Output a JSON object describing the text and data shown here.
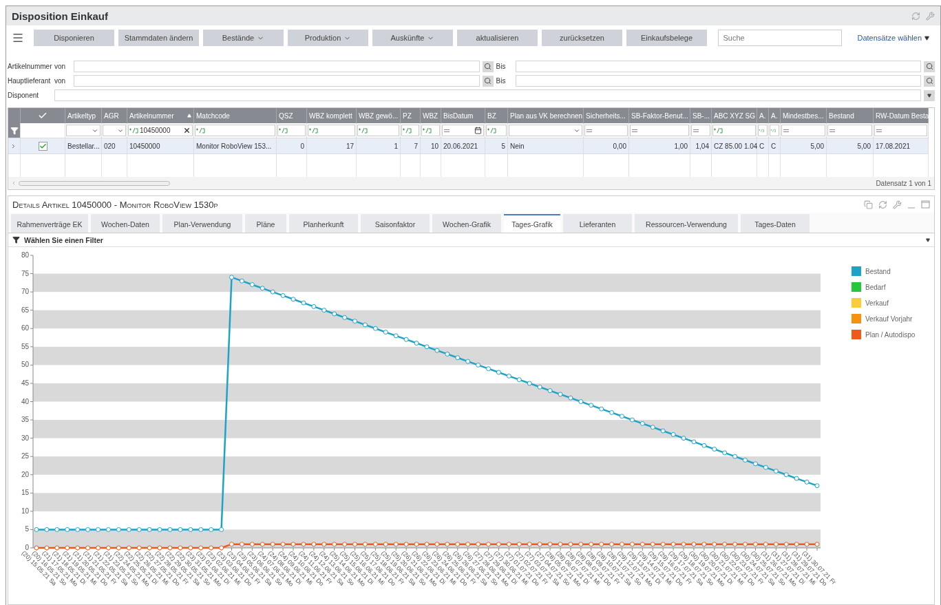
{
  "window": {
    "title": "Disposition Einkauf"
  },
  "toolbar": {
    "buttons": [
      {
        "label": "Disponieren",
        "dropdown": false
      },
      {
        "label": "Stammdaten ändern",
        "dropdown": false
      },
      {
        "label": "Bestände",
        "dropdown": true
      },
      {
        "label": "Produktion",
        "dropdown": true
      },
      {
        "label": "Auskünfte",
        "dropdown": true
      },
      {
        "label": "aktualisieren",
        "dropdown": false
      },
      {
        "label": "zurücksetzen",
        "dropdown": false
      },
      {
        "label": "Einkaufsbelege",
        "dropdown": false
      }
    ],
    "search": {
      "placeholder": "Suche"
    },
    "records_link": "Datensätze wählen"
  },
  "filters": [
    {
      "kind": "range",
      "label": "Artikelnummer",
      "from_label": "von",
      "to_label": "Bis"
    },
    {
      "kind": "range",
      "label": "Hauptlieferant",
      "from_label": "von",
      "to_label": "Bis"
    },
    {
      "kind": "select",
      "label": "Disponent"
    }
  ],
  "grid": {
    "columns": [
      {
        "kind": "check"
      },
      {
        "kind": "data",
        "label": "Artikeltyp",
        "filter": {
          "kind": "select"
        },
        "numeric": false,
        "sorted": false
      },
      {
        "kind": "data",
        "label": "AGR",
        "filter": {
          "kind": "select"
        },
        "numeric": false,
        "sorted": false
      },
      {
        "kind": "data",
        "label": "Artikelnummer",
        "filter": {
          "kind": "text",
          "value": "10450000"
        },
        "numeric": false,
        "sorted": true
      },
      {
        "kind": "data",
        "label": "Matchcode",
        "filter": {
          "kind": "text"
        },
        "numeric": false,
        "sorted": false
      },
      {
        "kind": "data",
        "label": "QSZ",
        "filter": {
          "kind": "text"
        },
        "numeric": true,
        "sorted": false
      },
      {
        "kind": "data",
        "label": "WBZ komplett",
        "filter": {
          "kind": "text"
        },
        "numeric": true,
        "sorted": false
      },
      {
        "kind": "data",
        "label": "WBZ gewö...",
        "filter": {
          "kind": "text"
        },
        "numeric": true,
        "sorted": false
      },
      {
        "kind": "data",
        "label": "PZ",
        "filter": {
          "kind": "text"
        },
        "numeric": true,
        "sorted": false
      },
      {
        "kind": "data",
        "label": "WBZ",
        "filter": {
          "kind": "text"
        },
        "numeric": true,
        "sorted": false
      },
      {
        "kind": "data",
        "label": "BisDatum",
        "filter": {
          "kind": "date"
        },
        "numeric": false,
        "sorted": false
      },
      {
        "kind": "data",
        "label": "BZ",
        "filter": {
          "kind": "text"
        },
        "numeric": true,
        "sorted": false
      },
      {
        "kind": "data",
        "label": "Plan aus VK berechnen",
        "filter": {
          "kind": "select"
        },
        "numeric": false,
        "sorted": false
      },
      {
        "kind": "data",
        "label": "Sicherheits...",
        "filter": {
          "kind": "equals"
        },
        "numeric": true,
        "sorted": false
      },
      {
        "kind": "data",
        "label": "SB-Faktor-Benut...",
        "filter": {
          "kind": "equals"
        },
        "numeric": true,
        "sorted": false
      },
      {
        "kind": "data",
        "label": "SB-...",
        "filter": {
          "kind": "equals"
        },
        "numeric": true,
        "sorted": false
      },
      {
        "kind": "data",
        "label": "ABC XYZ SG",
        "filter": {
          "kind": "text"
        },
        "numeric": false,
        "sorted": false
      },
      {
        "kind": "data",
        "label": "A.",
        "filter": {
          "kind": "text"
        },
        "numeric": false,
        "sorted": false
      },
      {
        "kind": "data",
        "label": "A.",
        "filter": {
          "kind": "text"
        },
        "numeric": false,
        "sorted": false
      },
      {
        "kind": "data",
        "label": "Mindestbes...",
        "filter": {
          "kind": "equals"
        },
        "numeric": true,
        "sorted": false
      },
      {
        "kind": "data",
        "label": "Bestand",
        "filter": {
          "kind": "equals"
        },
        "numeric": true,
        "sorted": false
      },
      {
        "kind": "data",
        "label": "RW-Datum Besta",
        "filter": {
          "kind": "equals"
        },
        "numeric": false,
        "sorted": false
      }
    ],
    "rows": [
      {
        "selected": true,
        "checked": true,
        "cells": [
          "",
          "Bestellar...",
          "020",
          "10450000",
          "Monitor RoboView 153...",
          "0",
          "17",
          "1",
          "7",
          "10",
          "20.06.2021",
          "5",
          "Nein",
          "0,00",
          "1,00",
          "1,04",
          "CZ 85.00 1.04",
          "C",
          "C",
          "5,00",
          "5,00",
          "17.08.2021"
        ]
      }
    ],
    "pager": "Datensatz 1 von 1"
  },
  "details": {
    "title": "Details Artikel 10450000 - Monitor RoboView 1530p",
    "tabs": [
      {
        "label": "Rahmenverträge EK",
        "selected": false
      },
      {
        "label": "Wochen-Daten",
        "selected": false
      },
      {
        "label": "Plan-Verwendung",
        "selected": false
      },
      {
        "label": "Pläne",
        "selected": false
      },
      {
        "label": "Planherkunft",
        "selected": false
      },
      {
        "label": "Saisonfaktor",
        "selected": false
      },
      {
        "label": "Wochen-Grafik",
        "selected": false
      },
      {
        "label": "Tages-Grafik",
        "selected": true
      },
      {
        "label": "Lieferanten",
        "selected": false
      },
      {
        "label": "Ressourcen-Verwendung",
        "selected": false
      },
      {
        "label": "Tages-Daten",
        "selected": false
      }
    ],
    "filter_placeholder": "Wählen Sie einen Filter",
    "chart_data": {
      "type": "line",
      "ylim": [
        0,
        80
      ],
      "yticks": [
        {
          "value": 0,
          "label": "0"
        },
        {
          "value": 5,
          "label": "5"
        },
        {
          "value": 10,
          "label": "10"
        },
        {
          "value": 15,
          "label": "15"
        },
        {
          "value": 20,
          "label": "20"
        },
        {
          "value": 25,
          "label": "25"
        },
        {
          "value": 30,
          "label": "30"
        },
        {
          "value": 35,
          "label": "35"
        },
        {
          "value": 40,
          "label": "40"
        },
        {
          "value": 45,
          "label": "45"
        },
        {
          "value": 50,
          "label": "50"
        },
        {
          "value": 55,
          "label": "55"
        },
        {
          "value": 60,
          "label": "60"
        },
        {
          "value": 65,
          "label": "65"
        },
        {
          "value": 70,
          "label": "70"
        },
        {
          "value": 75,
          "label": "75"
        },
        {
          "value": 80,
          "label": "80"
        }
      ],
      "categories": [
        "(20) 15.05.21 Sa",
        "(20) 16.05.21 So",
        "(21) 17.05.21 Mo",
        "(21) 18.05.21 Di",
        "(21) 19.05.21 Mi",
        "(21) 20.05.21 Do",
        "(21) 21.05.21 Fr",
        "(21) 22.05.21 Sa",
        "(21) 23.05.21 So",
        "(22) 24.05.21 Mo",
        "(22) 25.05.21 Di",
        "(22) 26.05.21 Mi",
        "(22) 27.05.21 Do",
        "(22) 28.05.21 Fr",
        "(22) 29.05.21 Sa",
        "(22) 30.05.21 So",
        "(23) 31.05.21 Mo",
        "(23) 01.06.21 Di",
        "(23) 02.06.21 Mi",
        "(23) 03.06.21 Do",
        "(23) 04.06.21 Fr",
        "(23) 05.06.21 Sa",
        "(23) 06.06.21 So",
        "(24) 07.06.21 Mo",
        "(24) 08.06.21 Di",
        "(24) 09.06.21 Mi",
        "(24) 10.06.21 Do",
        "(24) 11.06.21 Fr",
        "(24) 12.06.21 Sa",
        "(24) 13.06.21 So",
        "(25) 14.06.21 Mo",
        "(25) 15.06.21 Di",
        "(25) 16.06.21 Mi",
        "(25) 17.06.21 Do",
        "(25) 18.06.21 Fr",
        "(25) 19.06.21 Sa",
        "(25) 20.06.21 So",
        "(26) 21.06.21 Mo",
        "(26) 22.06.21 Di",
        "(26) 23.06.21 Mi",
        "(26) 24.06.21 Do",
        "(26) 25.06.21 Fr",
        "(26) 26.06.21 Sa",
        "(26) 27.06.21 So",
        "(27) 28.06.21 Mo",
        "(27) 29.06.21 Di",
        "(27) 30.06.21 Mi",
        "(27) 01.07.21 Do",
        "(27) 02.07.21 Fr",
        "(27) 03.07.21 Sa",
        "(27) 04.07.21 So",
        "(28) 05.07.21 Mo",
        "(28) 06.07.21 Di",
        "(28) 07.07.21 Mi",
        "(28) 08.07.21 Do",
        "(28) 09.07.21 Fr",
        "(28) 10.07.21 Sa",
        "(28) 11.07.21 So",
        "(29) 12.07.21 Mo",
        "(29) 13.07.21 Di",
        "(29) 14.07.21 Mi",
        "(29) 15.07.21 Do",
        "(29) 16.07.21 Fr",
        "(29) 17.07.21 Sa",
        "(29) 18.07.21 So",
        "(30) 19.07.21 Mo",
        "(30) 20.07.21 Di",
        "(30) 21.07.21 Mi",
        "(30) 22.07.21 Do",
        "(30) 23.07.21 Fr",
        "(30) 24.07.21 Sa",
        "(30) 25.07.21 So",
        "(31) 26.07.21 Mo",
        "(31) 27.07.21 Di",
        "(31) 28.07.21 Mi",
        "(31) 29.07.21 Do",
        "(31) 30.07.21 Fr"
      ],
      "series": [
        {
          "name": "Bestand",
          "color": "#1ea3c8",
          "marker": true,
          "values": [
            5,
            5,
            5,
            5,
            5,
            5,
            5,
            5,
            5,
            5,
            5,
            5,
            5,
            5,
            5,
            5,
            5,
            5,
            5,
            74,
            73,
            72,
            71,
            70,
            69,
            68,
            67,
            66,
            65,
            64,
            63,
            62,
            61,
            60,
            59,
            58,
            57,
            56,
            55,
            54,
            53,
            52,
            51,
            50,
            49,
            48,
            47,
            46,
            45,
            44,
            43,
            42,
            41,
            40,
            39,
            38,
            37,
            36,
            35,
            34,
            33,
            32,
            31,
            30,
            29,
            28,
            27,
            26,
            25,
            24,
            23,
            22,
            21,
            20,
            19,
            18,
            17
          ]
        },
        {
          "name": "Bedarf",
          "color": "#22c93a",
          "values": [
            null,
            null,
            null,
            null,
            null,
            null,
            null,
            null,
            null,
            null,
            null,
            null,
            null,
            null,
            null,
            null,
            null,
            null,
            null,
            null,
            null,
            null,
            null,
            null,
            null,
            null,
            null,
            null,
            null,
            null,
            null,
            null,
            null,
            null,
            null,
            null,
            null,
            null,
            null,
            null,
            null,
            null,
            null,
            null,
            null,
            null,
            null,
            null,
            null,
            null,
            null,
            null,
            null,
            null,
            null,
            null,
            null,
            null,
            null,
            null,
            null,
            null,
            null,
            null,
            null,
            null,
            null,
            null,
            null,
            null,
            null,
            null,
            null,
            null,
            null,
            null,
            null
          ]
        },
        {
          "name": "Verkauf",
          "color": "#f9cd3a",
          "values": [
            null,
            null,
            null,
            null,
            null,
            null,
            null,
            null,
            null,
            null,
            null,
            null,
            null,
            null,
            null,
            null,
            null,
            null,
            null,
            null,
            null,
            null,
            null,
            null,
            null,
            null,
            null,
            null,
            null,
            null,
            null,
            null,
            null,
            null,
            null,
            null,
            null,
            null,
            null,
            null,
            null,
            null,
            null,
            null,
            null,
            null,
            null,
            null,
            null,
            null,
            null,
            null,
            null,
            null,
            null,
            null,
            null,
            null,
            null,
            null,
            null,
            null,
            null,
            null,
            null,
            null,
            null,
            null,
            null,
            null,
            null,
            null,
            null,
            null,
            null,
            null,
            null
          ]
        },
        {
          "name": "Verkauf Vorjahr",
          "color": "#f7920f",
          "values": [
            null,
            null,
            null,
            null,
            null,
            null,
            null,
            null,
            null,
            null,
            null,
            null,
            null,
            null,
            null,
            null,
            null,
            null,
            null,
            null,
            null,
            null,
            null,
            null,
            null,
            null,
            null,
            null,
            null,
            null,
            null,
            null,
            null,
            null,
            null,
            null,
            null,
            null,
            null,
            null,
            null,
            null,
            null,
            null,
            null,
            null,
            null,
            null,
            null,
            null,
            null,
            null,
            null,
            null,
            null,
            null,
            null,
            null,
            null,
            null,
            null,
            null,
            null,
            null,
            null,
            null,
            null,
            null,
            null,
            null,
            null,
            null,
            null,
            null,
            null,
            null,
            null
          ]
        },
        {
          "name": "Plan / Autodispo",
          "color": "#ee5a1c",
          "marker": true,
          "values": [
            0,
            0,
            0,
            0,
            0,
            0,
            0,
            0,
            0,
            0,
            0,
            0,
            0,
            0,
            0,
            0,
            0,
            0,
            0,
            1,
            1,
            1,
            1,
            1,
            1,
            1,
            1,
            1,
            1,
            1,
            1,
            1,
            1,
            1,
            1,
            1,
            1,
            1,
            1,
            1,
            1,
            1,
            1,
            1,
            1,
            1,
            1,
            1,
            1,
            1,
            1,
            1,
            1,
            1,
            1,
            1,
            1,
            1,
            1,
            1,
            1,
            1,
            1,
            1,
            1,
            1,
            1,
            1,
            1,
            1,
            1,
            1,
            1,
            1,
            1,
            1,
            1
          ]
        }
      ]
    }
  }
}
